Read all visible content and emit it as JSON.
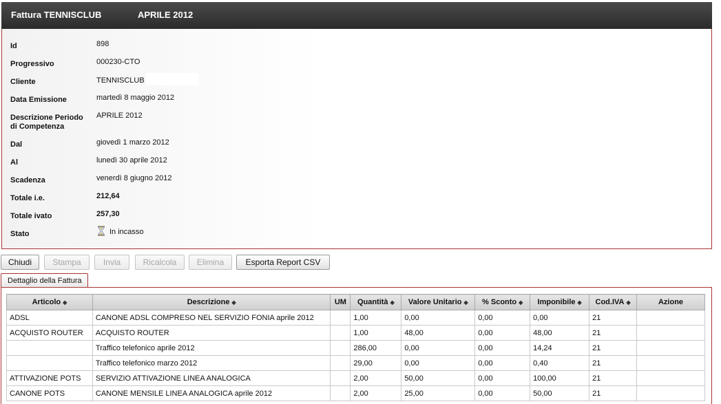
{
  "header": {
    "title": "Fattura TENNISCLUB",
    "period": "APRILE 2012"
  },
  "fields": [
    {
      "label": "Id",
      "value": "898"
    },
    {
      "label": "Progressivo",
      "value": "000230-CTO"
    },
    {
      "label": "Cliente",
      "value": "TENNISCLUB"
    },
    {
      "label": "Data Emissione",
      "value": "martedì 8 maggio 2012"
    },
    {
      "label": "Descrizione Periodo",
      "label2": "di Competenza",
      "value": "APRILE 2012"
    },
    {
      "label": "Dal",
      "value": "giovedì 1 marzo 2012"
    },
    {
      "label": "Al",
      "value": "lunedì 30 aprile 2012"
    },
    {
      "label": "Scadenza",
      "value": "venerdì 8 giugno 2012"
    },
    {
      "label": "Totale i.e.",
      "value": "212,64"
    },
    {
      "label": "Totale ivato",
      "value": "257,30"
    },
    {
      "label": "Stato",
      "value": "In incasso",
      "icon": "hourglass-icon"
    }
  ],
  "buttons": [
    {
      "label": "Chiudi",
      "enabled": true
    },
    {
      "label": "Stampa",
      "enabled": false
    },
    {
      "label": "Invia",
      "enabled": false
    },
    {
      "label": "Ricalcola",
      "enabled": false
    },
    {
      "label": "Elimina",
      "enabled": false
    },
    {
      "label": "Esporta Report CSV",
      "enabled": true
    }
  ],
  "tab": {
    "label": "Dettaglio della Fattura"
  },
  "table": {
    "headers": [
      "Articolo",
      "Descrizione",
      "UM",
      "Quantità",
      "Valore Unitario",
      "% Sconto",
      "Imponibile",
      "Cod.IVA",
      "Azione"
    ],
    "sortable": [
      true,
      true,
      false,
      true,
      true,
      true,
      true,
      true,
      false
    ],
    "rows": [
      [
        "ADSL",
        "CANONE ADSL COMPRESO NEL SERVIZIO FONIA aprile 2012",
        "",
        "1,00",
        "0,00",
        "0,00",
        "0,00",
        "21",
        ""
      ],
      [
        "ACQUISTO ROUTER",
        "ACQUISTO ROUTER",
        "",
        "1,00",
        "48,00",
        "0,00",
        "48,00",
        "21",
        ""
      ],
      [
        "",
        "Traffico telefonico aprile 2012",
        "",
        "286,00",
        "0,00",
        "0,00",
        "14,24",
        "21",
        ""
      ],
      [
        "",
        "Traffico telefonico marzo 2012",
        "",
        "29,00",
        "0,00",
        "0,00",
        "0,40",
        "21",
        ""
      ],
      [
        "ATTIVAZIONE POTS",
        "SERVIZIO ATTIVAZIONE LINEA ANALOGICA",
        "",
        "2,00",
        "50,00",
        "0,00",
        "100,00",
        "21",
        ""
      ],
      [
        "CANONE POTS",
        "CANONE MENSILE LINEA ANALOGICA aprile 2012",
        "",
        "2,00",
        "25,00",
        "0,00",
        "50,00",
        "21",
        ""
      ]
    ]
  },
  "colors": {
    "header_bg": "#2b2b2b",
    "border_accent": "#aa3333"
  }
}
